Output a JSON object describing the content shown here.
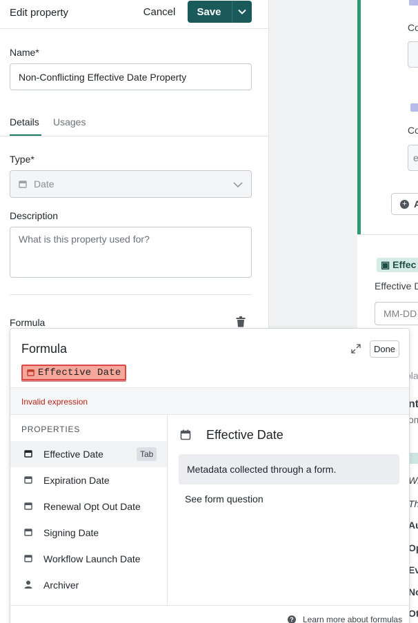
{
  "header": {
    "title": "Edit property",
    "cancel_label": "Cancel",
    "save_label": "Save"
  },
  "form": {
    "name_label": "Name*",
    "name_value": "Non-Conflicting Effective Date Property",
    "tabs": [
      {
        "label": "Details"
      },
      {
        "label": "Usages"
      }
    ],
    "type_label": "Type*",
    "type_value": "Date",
    "description_label": "Description",
    "description_placeholder": "What is this property used for?",
    "formula_label": "Formula"
  },
  "formula": {
    "title": "Formula",
    "done_label": "Done",
    "token": "Effective Date",
    "error": "Invalid expression",
    "section_label": "PROPERTIES",
    "properties": [
      {
        "label": "Effective Date",
        "icon": "calendar-icon",
        "hint": "Tab"
      },
      {
        "label": "Expiration Date",
        "icon": "calendar-icon"
      },
      {
        "label": "Renewal Opt Out Date",
        "icon": "calendar-icon"
      },
      {
        "label": "Signing Date",
        "icon": "calendar-icon"
      },
      {
        "label": "Workflow Launch Date",
        "icon": "calendar-icon"
      },
      {
        "label": "Archiver",
        "icon": "person-icon"
      }
    ],
    "detail": {
      "title": "Effective Date",
      "description": "Metadata collected through a form.",
      "link": "See form question"
    },
    "learn_more": "Learn more about formulas"
  },
  "background": {
    "fragments": [
      "Co",
      "Co",
      "e",
      "A",
      "Effec",
      "Effective D",
      "MM-DD",
      "pla",
      "nt",
      "om",
      "Wl",
      "Th",
      "Au",
      "Op",
      "Ev",
      "No",
      "Ot"
    ]
  },
  "colors": {
    "accent": "#1b5a5a",
    "error": "#b42318",
    "token_bg": "#f4a79a",
    "green_bar": "#2e9a72"
  }
}
